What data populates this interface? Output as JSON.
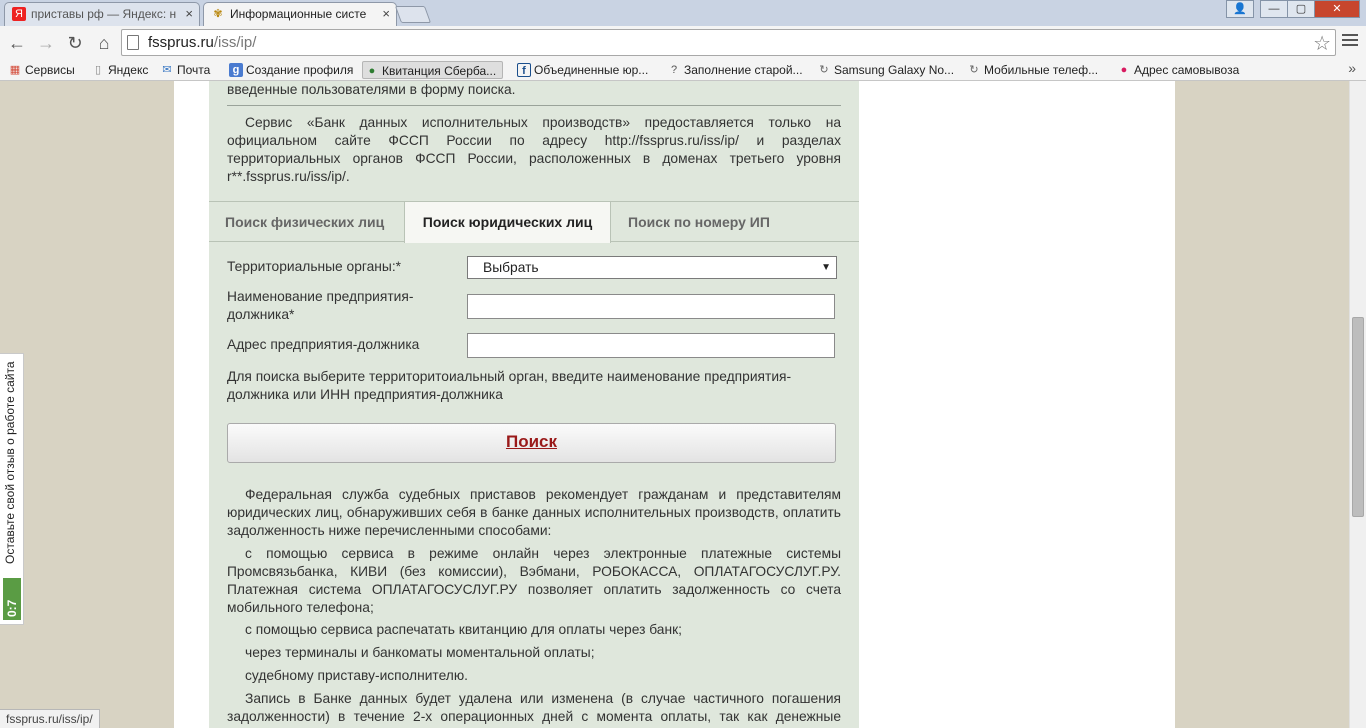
{
  "browser": {
    "tabs": [
      {
        "title": "приставы рф — Яндекс: н",
        "favicon": "Я",
        "close": "×"
      },
      {
        "title": "Информационные систе",
        "favicon": "✾",
        "close": "×"
      }
    ],
    "url_host": "fssprus.ru",
    "url_path": "/iss/ip/",
    "nav": {
      "back": "←",
      "forward": "→",
      "reload": "↻",
      "home": "⌂",
      "star": "☆"
    },
    "window_buttons": {
      "user": "👤",
      "minimize": "—",
      "maximize": "▢",
      "close": "✕"
    },
    "bookmarks": [
      {
        "label": "Сервисы",
        "icon": "▦",
        "color": "#d34836"
      },
      {
        "label": "Яндекс",
        "icon": "▯",
        "color": "#888888"
      },
      {
        "label": "Почта",
        "icon": "✉",
        "color": "#3a78c3"
      },
      {
        "label": "Создание профиля",
        "icon": "g",
        "color": "#4a7bd0"
      },
      {
        "label": "Квитанция Сберба...",
        "icon": "●",
        "color": "#2e7d32"
      },
      {
        "label": "Объединенные юр...",
        "icon": "f",
        "color": "#1a4e8c"
      },
      {
        "label": "Заполнение старой...",
        "icon": "?",
        "color": "#555555"
      },
      {
        "label": "Samsung Galaxy No...",
        "icon": "↻",
        "color": "#666666"
      },
      {
        "label": "Мобильные телеф...",
        "icon": "↻",
        "color": "#666666"
      },
      {
        "label": "Адрес самовывоза",
        "icon": "●",
        "color": "#d81b60"
      }
    ],
    "bookmarks_more": "»",
    "status_text": "fssprus.ru/iss/ip/"
  },
  "page": {
    "top_partial": "введенные пользователями в форму поиска.",
    "notice": "Сервис «Банк данных исполнительных производств» предоставляется только на официальном сайте ФССП России по адресу http://fssprus.ru/iss/ip/ и разделах территориальных органов ФССП России, расположенных в доменах третьего уровня r**.fssprus.ru/iss/ip/.",
    "search_tabs": [
      "Поиск физических лиц",
      "Поиск юридических лиц",
      "Поиск по номеру ИП"
    ],
    "form": {
      "territorial_label": "Территориальные органы:*",
      "territorial_value": "Выбрать",
      "company_label": "Наименование предприятия-должника*",
      "company_value": "",
      "address_label": "Адрес предприятия-должника",
      "address_value": "",
      "hint": "Для поиска выберите территоритоиальный орган, введите наименование предприятия-должника или ИНН предприятия-должника",
      "search_button": "Поиск"
    },
    "info": [
      "Федеральная служба судебных приставов рекомендует гражданам и представителям юридических лиц, обнаруживших себя в банке данных исполнительных производств, оплатить задолженность ниже перечисленными способами:",
      "с помощью сервиса в режиме онлайн через электронные платежные системы Промсвязьбанка, КИВИ (без комиссии), Вэбмани, РОБОКАССА, ОПЛАТАГОСУСЛУГ.РУ. Платежная система ОПЛАТАГОСУСЛУГ.РУ позволяет оплатить задолженность со счета мобильного телефона;",
      "с помощью сервиса распечатать квитанцию для оплаты через банк;",
      "через терминалы и банкоматы моментальной оплаты;",
      "судебному приставу-исполнителю.",
      "Запись в Банке данных будет удалена или изменена (в случае частичного погашения задолженности) в течение 2-х операционных дней с момента оплаты, так как денежные средства должны"
    ],
    "feedback": {
      "text": "Оставьте свой отзыв о работе сайта",
      "badge": "0:7"
    }
  }
}
